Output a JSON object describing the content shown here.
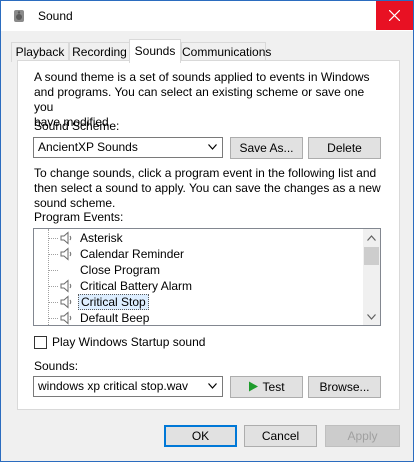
{
  "window": {
    "title": "Sound"
  },
  "tabs": [
    {
      "label": "Playback"
    },
    {
      "label": "Recording"
    },
    {
      "label": "Sounds"
    },
    {
      "label": "Communications"
    }
  ],
  "sounds_tab": {
    "intro_lines": [
      "A sound theme is a set of sounds applied to events in Windows",
      "and programs.  You can select an existing scheme or save one you",
      "have modified."
    ],
    "scheme_label": "Sound Scheme:",
    "scheme_value": "AncientXP Sounds",
    "save_as_label": "Save As...",
    "delete_label": "Delete",
    "change_lines": [
      "To change sounds, click a program event in the following list and",
      "then select a sound to apply.  You can save the changes as a new",
      "sound scheme."
    ],
    "events_label": "Program Events:",
    "events": [
      {
        "label": "Asterisk",
        "has_sound": true
      },
      {
        "label": "Calendar Reminder",
        "has_sound": true
      },
      {
        "label": "Close Program",
        "has_sound": false
      },
      {
        "label": "Critical Battery Alarm",
        "has_sound": true
      },
      {
        "label": "Critical Stop",
        "has_sound": true,
        "selected": true
      },
      {
        "label": "Default Beep",
        "has_sound": true
      }
    ],
    "startup_label": "Play Windows Startup sound",
    "startup_checked": false,
    "sounds_label": "Sounds:",
    "sound_file": "windows xp critical stop.wav",
    "test_label": "Test",
    "browse_label": "Browse..."
  },
  "footer": {
    "ok_label": "OK",
    "cancel_label": "Cancel",
    "apply_label": "Apply"
  },
  "colors": {
    "close_red": "#e81123",
    "accent": "#0078d7",
    "play_green": "#1e9c2c"
  }
}
